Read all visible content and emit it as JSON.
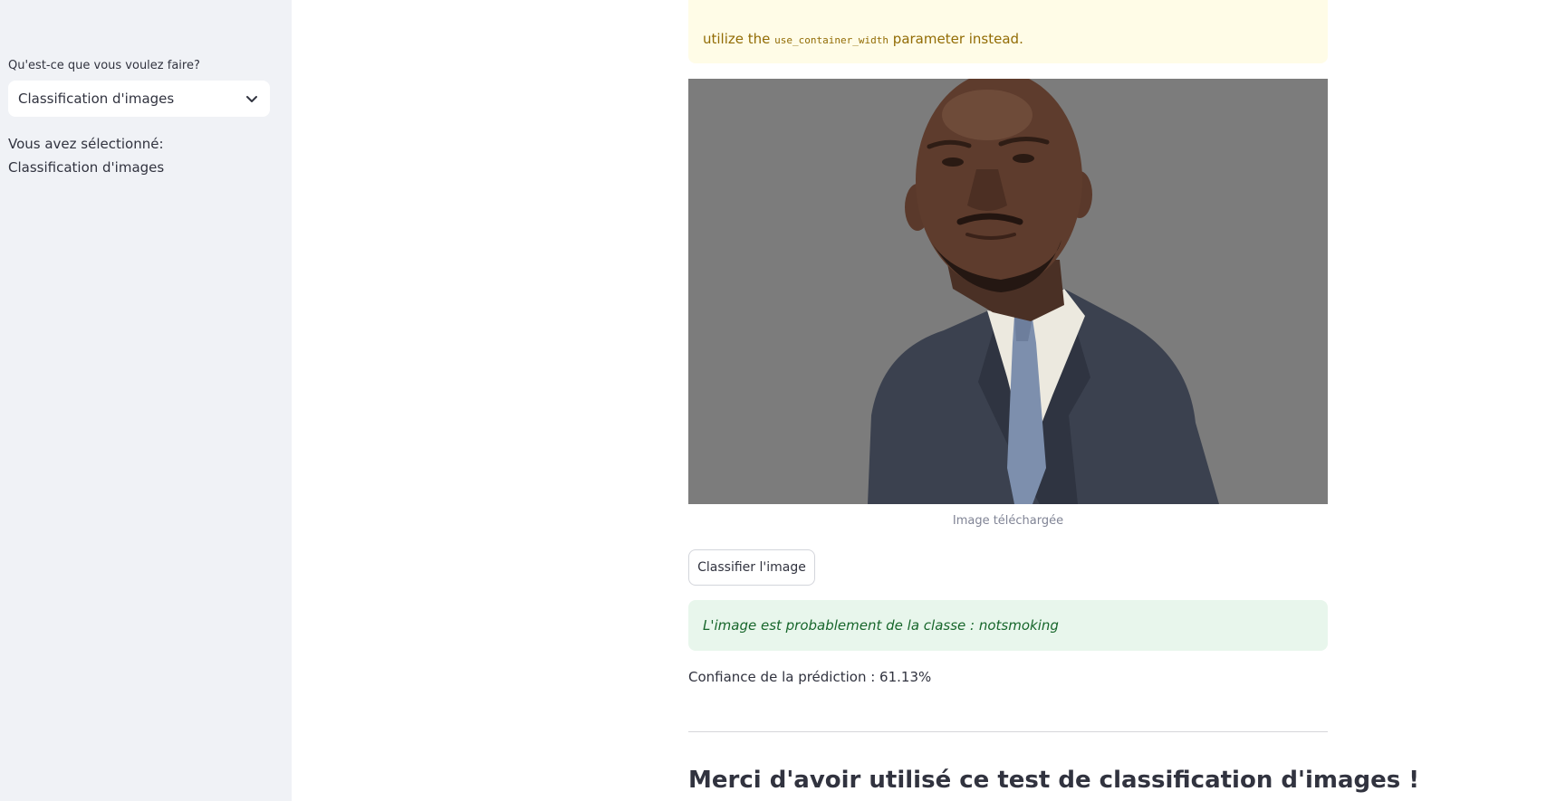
{
  "sidebar": {
    "select_label": "Qu'est-ce que vous voulez faire?",
    "select_value": "Classification d'images",
    "selected_text": "Vous avez sélectionné: Classification d'images"
  },
  "main": {
    "warning": {
      "prefix": "utilize the",
      "code": "use_container_width",
      "suffix": "parameter instead."
    },
    "image_caption": "Image téléchargée",
    "classify_button": "Classifier l'image",
    "result_text": "L'image est probablement de la classe : notsmoking",
    "confidence_text": "Confiance de la prédiction : 61.13%",
    "thanks_heading": "Merci d'avoir utilisé ce test de classification d'images !"
  },
  "colors": {
    "sidebar_bg": "#f0f2f6",
    "warning_bg": "#fffce7",
    "warning_text": "#926c05",
    "success_bg": "#e8f6ec",
    "success_text": "#17662b"
  }
}
